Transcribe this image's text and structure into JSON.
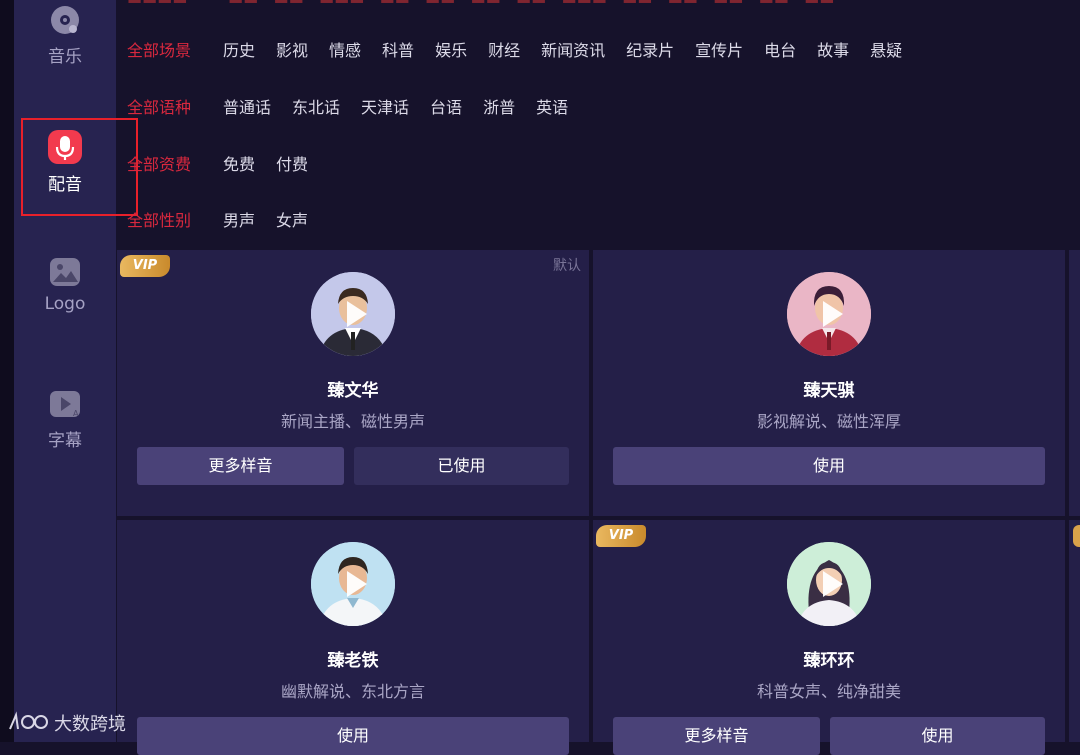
{
  "sidebar": {
    "items": [
      {
        "label": "音乐",
        "icon": "music-disc-icon"
      },
      {
        "label": "配音",
        "icon": "microphone-icon",
        "active": true
      },
      {
        "label": "Logo",
        "icon": "image-icon"
      },
      {
        "label": "字幕",
        "icon": "subtitle-icon"
      }
    ]
  },
  "filters": {
    "scene": {
      "all": "全部场景",
      "options": [
        "历史",
        "影视",
        "情感",
        "科普",
        "娱乐",
        "财经",
        "新闻资讯",
        "纪录片",
        "宣传片",
        "电台",
        "故事",
        "悬疑"
      ]
    },
    "language": {
      "all": "全部语种",
      "options": [
        "普通话",
        "东北话",
        "天津话",
        "台语",
        "浙普",
        "英语"
      ]
    },
    "fee": {
      "all": "全部资费",
      "options": [
        "免费",
        "付费"
      ]
    },
    "gender": {
      "all": "全部性别",
      "options": [
        "男声",
        "女声"
      ]
    }
  },
  "cards": [
    {
      "name": "臻文华",
      "desc": "新闻主播、磁性男声",
      "vip": "VIP",
      "default_tag": "默认",
      "buttons": [
        "更多样音",
        "已使用"
      ]
    },
    {
      "name": "臻天骐",
      "desc": "影视解说、磁性浑厚",
      "buttons": [
        "使用"
      ]
    },
    {
      "name": "臻老铁",
      "desc": "幽默解说、东北方言",
      "buttons": [
        "使用"
      ]
    },
    {
      "name": "臻环环",
      "desc": "科普女声、纯净甜美",
      "vip": "VIP",
      "buttons": [
        "更多样音",
        "使用"
      ]
    }
  ],
  "watermark": {
    "text": "大数跨境"
  },
  "colors": {
    "accent_red": "#d8283e",
    "highlight_border": "#e8202a",
    "vip_gold": "#e0a84a",
    "card_bg": "#241f48",
    "sidebar_bg": "#272350"
  }
}
